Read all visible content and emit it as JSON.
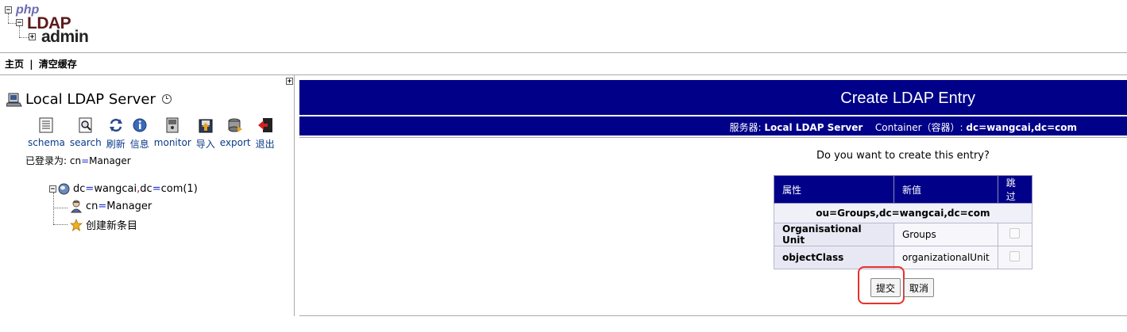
{
  "logo": {
    "php": "php",
    "ldap": "LDAP",
    "admin": "admin"
  },
  "topnav": {
    "home": "主页",
    "separator": "|",
    "purge_cache": "清空缓存"
  },
  "left": {
    "server_title": "Local LDAP Server",
    "toolbar": [
      {
        "label": "schema",
        "icon": "schema-icon"
      },
      {
        "label": "search",
        "icon": "search-icon"
      },
      {
        "label": "刷新",
        "icon": "refresh-icon"
      },
      {
        "label": "信息",
        "icon": "info-icon"
      },
      {
        "label": "monitor",
        "icon": "monitor-icon"
      },
      {
        "label": "导入",
        "icon": "import-icon"
      },
      {
        "label": "export",
        "icon": "export-icon"
      },
      {
        "label": "退出",
        "icon": "logout-icon"
      }
    ],
    "logged_in_prefix": "已登录为: cn",
    "logged_in_eq": "=",
    "logged_in_user": "Manager",
    "tree": {
      "root": {
        "p1": "dc",
        "eq1": "=",
        "p2": "wangcai",
        "comma": ",",
        "p3": "dc",
        "eq2": "=",
        "p4": "com",
        "count": " (1)"
      },
      "manager": {
        "p1": "cn",
        "eq": "=",
        "p2": "Manager"
      },
      "create_new": "创建新条目"
    }
  },
  "right": {
    "title": "Create LDAP Entry",
    "server_label": "服务器:",
    "server_name": "Local LDAP Server",
    "container_label": "Container（容器）:",
    "container_dn": "dc=wangcai,dc=com",
    "question": "Do you want to create this entry?",
    "table": {
      "headers": [
        "属性",
        "新值",
        "跳过"
      ],
      "dn": "ou=Groups,dc=wangcai,dc=com",
      "rows": [
        {
          "attr": "Organisational Unit",
          "value": "Groups",
          "skip": false
        },
        {
          "attr": "objectClass",
          "value": "organizationalUnit",
          "skip": false
        }
      ]
    },
    "submit_label": "提交",
    "cancel_label": "取消"
  },
  "colors": {
    "header_bg": "#000088",
    "highlight": "#e8302a",
    "link": "#0a3a8a"
  }
}
